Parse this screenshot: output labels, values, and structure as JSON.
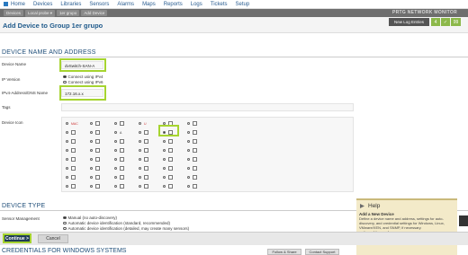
{
  "nav": {
    "items": [
      "Home",
      "Devices",
      "Libraries",
      "Sensors",
      "Alarms",
      "Maps",
      "Reports",
      "Logs",
      "Tickets",
      "Setup"
    ]
  },
  "breadcrumbs": [
    "Devices",
    "Local probe ▾",
    "1er grupo",
    "Add Device"
  ],
  "brand": "PRTG NETWORK MONITOR",
  "page_title": "Add Device to Group 1er grupo",
  "header_buttons": {
    "log": "New Log Entries",
    "count": "4",
    "ok": "✓",
    "ok2": "99"
  },
  "sections": {
    "name_address": "DEVICE NAME AND ADDRESS",
    "type": "DEVICE TYPE",
    "credentials": "CREDENTIALS FOR WINDOWS SYSTEMS"
  },
  "fields": {
    "device_name": {
      "label": "Device Name",
      "value": "dvSwitch-SAN-A"
    },
    "ip_version": {
      "label": "IP Version",
      "options": [
        "Connect using IPv4",
        "Connect using IPv6"
      ]
    },
    "ipv4": {
      "label": "IPv4-Address/DNS Name",
      "value": "172.16.x.x"
    },
    "tags": {
      "label": "Tags"
    },
    "device_icon": {
      "label": "Device Icon"
    },
    "sensor_mgmt": {
      "label": "Sensor Management",
      "options": [
        "Manual (no auto-discovery)",
        "Automatic device identification (standard, recommended)",
        "Automatic device identification (detailed, may create many sensors)"
      ]
    }
  },
  "icon_grid_labels": {
    "mac": "MAC",
    "a": "A",
    "u": "U"
  },
  "help": {
    "title": "Help",
    "subtitle": "Add a New Device",
    "body": "Define a device name and address, settings for auto-discovery, and credential settings for Windows, Linux, VMware/XEN, and SNMP, if necessary.",
    "link": "Help: Add a Device",
    "more": "Need More Help? Click here to visit the Help Center!"
  },
  "buttons": {
    "continue": "Continue >",
    "cancel": "Cancel",
    "follow": "Follow & Share",
    "support": "Contact Support"
  }
}
